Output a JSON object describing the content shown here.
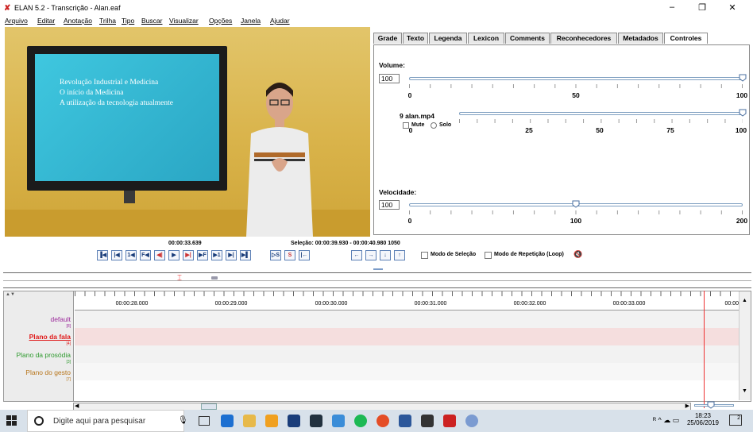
{
  "window": {
    "title": "ELAN 5.2 - Transcrição - Alan.eaf"
  },
  "menu": [
    "Arquivo",
    "Editar",
    "Anotação",
    "Trilha",
    "Tipo",
    "Buscar",
    "Visualizar",
    "Opções",
    "Janela",
    "Ajudar"
  ],
  "video": {
    "slide_lines": [
      "Revolução Industrial e Medicina",
      "O início da Medicina",
      "A utilização da tecnologia atualmente"
    ]
  },
  "tabs": [
    "Grade",
    "Texto",
    "Legenda",
    "Lexicon",
    "Comments",
    "Reconhecedores",
    "Metadados",
    "Controles"
  ],
  "active_tab": "Controles",
  "controls": {
    "volume": {
      "label": "Volume:",
      "value": "100",
      "ticks": [
        "0",
        "50",
        "100"
      ],
      "level": 1.0
    },
    "media": {
      "name": "9 alan.mp4",
      "mute_label": "Mute",
      "solo_label": "Solo",
      "ticks": [
        "0",
        "25",
        "50",
        "75",
        "100"
      ],
      "level": 1.0
    },
    "speed": {
      "label": "Velocidade:",
      "value": "100",
      "ticks": [
        "0",
        "100",
        "200"
      ],
      "level": 0.5
    }
  },
  "transport": {
    "time": "00:00:33.639",
    "selection": "Seleção: 00:00:39.930 - 00:00:40.980  1050",
    "buttons": [
      "▐◀",
      "|◀",
      "1◀",
      "F◀",
      "◀|",
      "▶",
      "▶|",
      "▶F",
      "▶1",
      "▶|",
      "▶▌"
    ],
    "sel_buttons": [
      "▷S",
      "S",
      "|←"
    ],
    "nav_buttons": [
      "←",
      "→",
      "↓",
      "↑"
    ],
    "mode_selection": "Modo de Seleção",
    "mode_loop": "Modo de Repetição (Loop)",
    "speaker_icon": "🔇"
  },
  "timeline": {
    "ticks": [
      "00:00:28.000",
      "00:00:29.000",
      "00:00:30.000",
      "00:00:31.000",
      "00:00:32.000",
      "00:00:33.000",
      "00:00:"
    ],
    "tiers": [
      {
        "name": "default",
        "count": "[8]",
        "color": "#9b2a9b"
      },
      {
        "name": "Plano da fala",
        "count": "[4]",
        "color": "#e01b1b"
      },
      {
        "name": "Plano da prosódia",
        "count": "[3]",
        "color": "#2f9a2f"
      },
      {
        "name": "Plano do gesto",
        "count": "[7]",
        "color": "#b8761d"
      }
    ]
  },
  "taskbar": {
    "search_placeholder": "Digite aqui para pesquisar",
    "time": "18:23",
    "date": "25/06/2019",
    "notif_count": "2"
  }
}
